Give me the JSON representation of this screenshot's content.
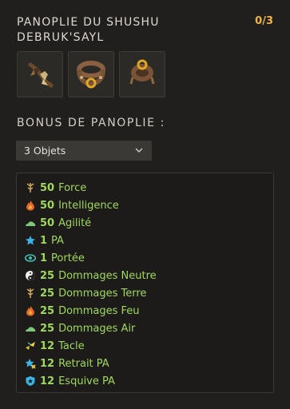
{
  "set": {
    "title": "PANOPLIE DU SHUSHU DEBRUK'SAYL",
    "count": "0/3",
    "items": [
      {
        "name": "item-feather-amulet",
        "icon": "feather-trinket-icon"
      },
      {
        "name": "item-ring-belt",
        "icon": "ring-belt-icon"
      },
      {
        "name": "item-ring-belt-2",
        "icon": "ring-belt-alt-icon"
      }
    ]
  },
  "bonus": {
    "title": "BONUS DE PANOPLIE :",
    "selected": "3 Objets",
    "rows": [
      {
        "icon": "force-icon",
        "value": "50",
        "label": "Force"
      },
      {
        "icon": "intelligence-icon",
        "value": "50",
        "label": "Intelligence"
      },
      {
        "icon": "agility-icon",
        "value": "50",
        "label": "Agilité"
      },
      {
        "icon": "pa-icon",
        "value": "1",
        "label": "PA"
      },
      {
        "icon": "range-icon",
        "value": "1",
        "label": "Portée"
      },
      {
        "icon": "neutral-icon",
        "value": "25",
        "label": "Dommages Neutre"
      },
      {
        "icon": "earth-icon",
        "value": "25",
        "label": "Dommages Terre"
      },
      {
        "icon": "fire-icon",
        "value": "25",
        "label": "Dommages Feu"
      },
      {
        "icon": "air-icon",
        "value": "25",
        "label": "Dommages Air"
      },
      {
        "icon": "tackle-icon",
        "value": "12",
        "label": "Tacle"
      },
      {
        "icon": "ap-reduction-icon",
        "value": "12",
        "label": "Retrait PA"
      },
      {
        "icon": "ap-dodge-icon",
        "value": "12",
        "label": "Esquive PA"
      }
    ]
  },
  "colors": {
    "accent_count": "#f0b44a",
    "bonus_text": "#9fd85a"
  }
}
